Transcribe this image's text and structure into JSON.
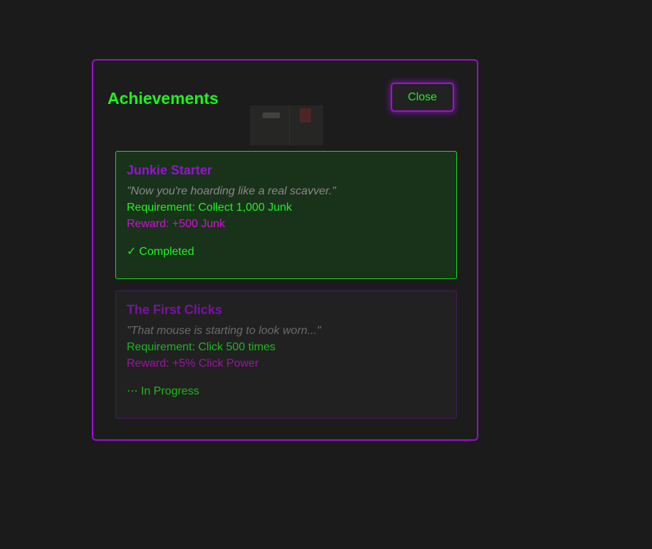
{
  "modal": {
    "title": "Achievements",
    "close_label": "Close"
  },
  "achievements": [
    {
      "name": "Junkie Starter",
      "quote": "\"Now you're hoarding like a real scavver.\"",
      "requirement": "Requirement: Collect 1,000 Junk",
      "reward": "Reward: +500 Junk",
      "status_icon": "✓",
      "status_icon_name": "checkmark-icon",
      "status": "Completed"
    },
    {
      "name": "The First Clicks",
      "quote": "\"That mouse is starting to look worn...\"",
      "requirement": "Requirement: Click 500 times",
      "reward": "Reward: +5% Click Power",
      "status_icon": "⋯",
      "status_icon_name": "ellipsis-icon",
      "status": "In Progress"
    }
  ],
  "colors": {
    "background": "#1b1b1b",
    "accent_purple": "#9a0fcf",
    "accent_green": "#1cf51c",
    "reward_magenta": "#d012d8",
    "completed_card_bg": "#19321a"
  }
}
